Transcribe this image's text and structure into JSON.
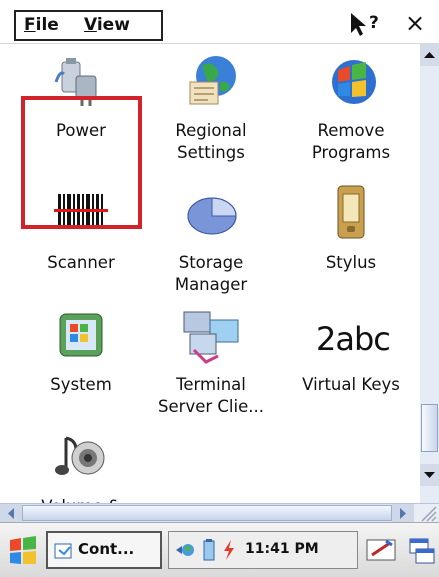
{
  "menu": {
    "file_label": "File",
    "view_label": "View",
    "help_icon": "help-pointer-icon",
    "close_symbol": "×"
  },
  "items": [
    {
      "key": "power",
      "line1": "Power",
      "line2": "",
      "icon": "power-icon",
      "selected": true
    },
    {
      "key": "regional",
      "line1": "Regional",
      "line2": "Settings",
      "icon": "regional-settings-icon"
    },
    {
      "key": "remove",
      "line1": "Remove",
      "line2": "Programs",
      "icon": "remove-programs-icon"
    },
    {
      "key": "scanner",
      "line1": "Scanner",
      "line2": "",
      "icon": "barcode-icon"
    },
    {
      "key": "storage",
      "line1": "Storage",
      "line2": "Manager",
      "icon": "storage-manager-icon"
    },
    {
      "key": "stylus",
      "line1": "Stylus",
      "line2": "",
      "icon": "stylus-icon"
    },
    {
      "key": "system",
      "line1": "System",
      "line2": "",
      "icon": "system-icon"
    },
    {
      "key": "terminal",
      "line1": "Terminal",
      "line2": "Server Clie...",
      "icon": "terminal-server-icon"
    },
    {
      "key": "virtual",
      "line1": "Virtual Keys",
      "line2": "",
      "icon": "virtual-keys-icon",
      "glyph": "2abc"
    },
    {
      "key": "volume",
      "line1": "Volume &",
      "line2": "",
      "icon": "volume-icon"
    }
  ],
  "taskbar": {
    "task_label": "Cont...",
    "clock": "11:41 PM"
  },
  "colors": {
    "selection_outline": "#d2232a",
    "scrollbar": "#e6ecf5"
  }
}
